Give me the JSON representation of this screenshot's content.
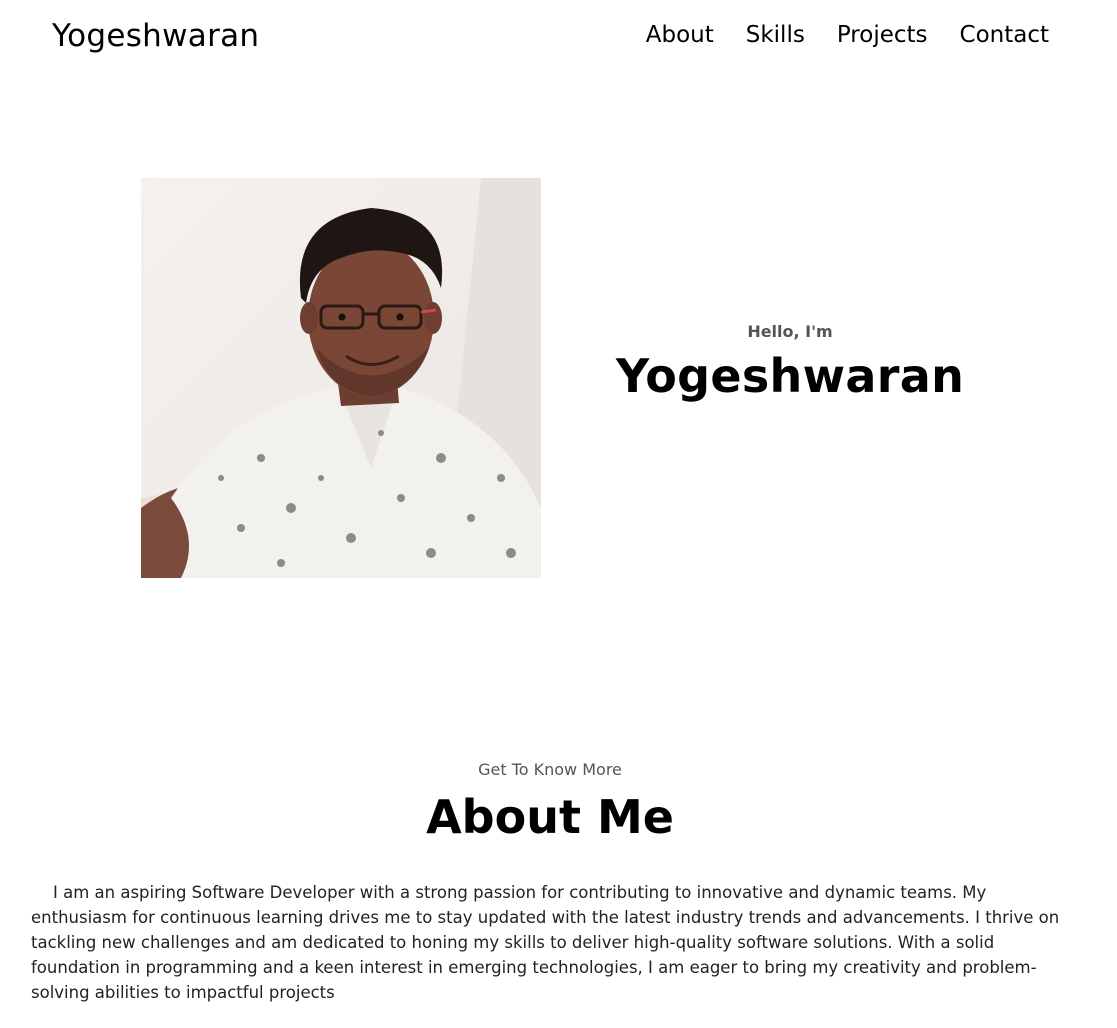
{
  "nav": {
    "logo": "Yogeshwaran",
    "links": [
      "About",
      "Skills",
      "Projects",
      "Contact"
    ]
  },
  "hero": {
    "greeting": "Hello, I'm",
    "name": "Yogeshwaran",
    "image_alt": "profile-photo"
  },
  "about": {
    "subtitle": "Get To Know More",
    "title": "About Me",
    "text": "I am an aspiring Software Developer with a strong passion for contributing to innovative and dynamic teams. My enthusiasm for continuous learning drives me to stay updated with the latest industry trends and advancements. I thrive on tackling new challenges and am dedicated to honing my skills to deliver high-quality software solutions. With a solid foundation in programming and a keen interest in emerging technologies, I am eager to bring my creativity and problem-solving abilities to impactful projects"
  }
}
